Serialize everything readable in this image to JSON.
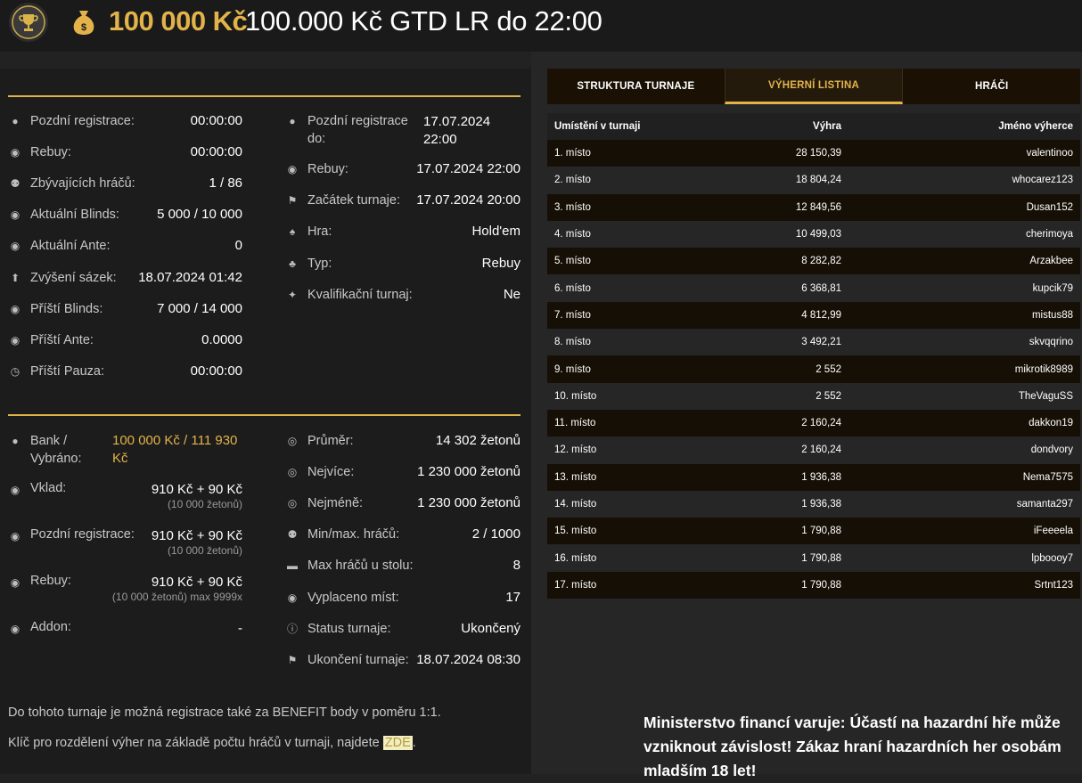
{
  "header": {
    "amount": "100 000 Kč",
    "title": "100.000 Kč GTD LR do 22:00"
  },
  "status_left": [
    {
      "icon": "user-icon",
      "label": "Pozdní registrace:",
      "value": "00:00:00"
    },
    {
      "icon": "chips-icon",
      "label": "Rebuy:",
      "value": "00:00:00"
    },
    {
      "icon": "users-icon",
      "label": "Zbývajících hráčů:",
      "value": "1 / 86"
    },
    {
      "icon": "chips-icon",
      "label": "Aktuální Blinds:",
      "value": "5 000 / 10 000"
    },
    {
      "icon": "coin-icon",
      "label": "Aktuální Ante:",
      "value": "0"
    },
    {
      "icon": "arrow-up-circle-icon",
      "label": "Zvýšení sázek:",
      "value": "18.07.2024 01:42"
    },
    {
      "icon": "chips-icon",
      "label": "Příští Blinds:",
      "value": "7 000 / 14 000"
    },
    {
      "icon": "coin-icon",
      "label": "Příští Ante:",
      "value": "0.0000"
    },
    {
      "icon": "clock-icon",
      "label": "Příští Pauza:",
      "value": "00:00:00"
    }
  ],
  "status_right": [
    {
      "icon": "user-icon",
      "label": "Pozdní registrace do:",
      "value": "17.07.2024 22:00"
    },
    {
      "icon": "chips-icon",
      "label": "Rebuy:",
      "value": "17.07.2024 22:00"
    },
    {
      "icon": "flag-icon",
      "label": "Začátek turnaje:",
      "value": "17.07.2024 20:00"
    },
    {
      "icon": "cards-icon",
      "label": "Hra:",
      "value": "Hold'em"
    },
    {
      "icon": "suits-icon",
      "label": "Typ:",
      "value": "Rebuy"
    },
    {
      "icon": "medal-icon",
      "label": "Kvalifikační turnaj:",
      "value": "Ne"
    }
  ],
  "money_left": {
    "bank": {
      "label": "Bank / Vybráno:",
      "value": "100 000 Kč / 111 930 Kč"
    },
    "deposit": {
      "label": "Vklad:",
      "value": "910 Kč + 90 Kč",
      "sub": "(10 000 žetonů)"
    },
    "late_reg": {
      "label": "Pozdní registrace:",
      "value": "910 Kč + 90 Kč",
      "sub": "(10 000 žetonů)"
    },
    "rebuy": {
      "label": "Rebuy:",
      "value": "910 Kč + 90 Kč",
      "sub": "(10 000 žetonů) max 9999x"
    },
    "addon": {
      "label": "Addon:",
      "value": "-"
    }
  },
  "money_right": [
    {
      "icon": "chip-icon",
      "label": "Průměr:",
      "value": "14 302 žetonů"
    },
    {
      "icon": "chip-icon",
      "label": "Nejvíce:",
      "value": "1 230 000 žetonů"
    },
    {
      "icon": "chip-icon",
      "label": "Nejméně:",
      "value": "1 230 000 žetonů"
    },
    {
      "icon": "users-icon",
      "label": "Min/max. hráčů:",
      "value": "2 / 1000"
    },
    {
      "icon": "table-icon",
      "label": "Max hráčů u stolu:",
      "value": "8"
    },
    {
      "icon": "payout-icon",
      "label": "Vyplaceno míst:",
      "value": "17"
    },
    {
      "icon": "info-icon",
      "label": "Status turnaje:",
      "value": "Ukončený"
    },
    {
      "icon": "flag-icon",
      "label": "Ukončení turnaje:",
      "value": "18.07.2024 08:30"
    }
  ],
  "notes": {
    "benefit": "Do tohoto turnaje je možná registrace také za BENEFIT body v poměru 1:1.",
    "key_text": "Klíč pro rozdělení výher na základě počtu hráčů v turnaji, najdete",
    "key_link": "ZDE",
    "key_end": "."
  },
  "tabs": [
    "STRUKTURA TURNAJE",
    "VÝHERNÍ LISTINA",
    "HRÁČI"
  ],
  "table": {
    "headers": [
      "Umístění v turnaji",
      "Výhra",
      "Jméno výherce"
    ],
    "rows": [
      [
        "1. místo",
        "28 150,39",
        "valentinoo"
      ],
      [
        "2. místo",
        "18 804,24",
        "whocarez123"
      ],
      [
        "3. místo",
        "12 849,56",
        "Dusan152"
      ],
      [
        "4. místo",
        "10 499,03",
        "cherimoya"
      ],
      [
        "5. místo",
        "8 282,82",
        "Arzakbee"
      ],
      [
        "6. místo",
        "6 368,81",
        "kupcik79"
      ],
      [
        "7. místo",
        "4 812,99",
        "mistus88"
      ],
      [
        "8. místo",
        "3 492,21",
        "skvqqrino"
      ],
      [
        "9. místo",
        "2 552",
        "mikrotik8989"
      ],
      [
        "10. místo",
        "2 552",
        "TheVaguSS"
      ],
      [
        "11. místo",
        "2 160,24",
        "dakkon19"
      ],
      [
        "12. místo",
        "2 160,24",
        "dondvory"
      ],
      [
        "13. místo",
        "1 936,38",
        "Nema7575"
      ],
      [
        "14. místo",
        "1 936,38",
        "samanta297"
      ],
      [
        "15. místo",
        "1 790,88",
        "iFeeeela"
      ],
      [
        "16. místo",
        "1 790,88",
        "lpbooоy7"
      ],
      [
        "17. místo",
        "1 790,88",
        "Srtnt123"
      ]
    ]
  },
  "warning": "Ministerstvo financí varuje: Účastí na hazardní hře může vzniknout závislost! Zákaz hraní hazardních her osobám mladším 18 let!",
  "colors": {
    "accent": "#e3b34a",
    "background": "#222222"
  }
}
